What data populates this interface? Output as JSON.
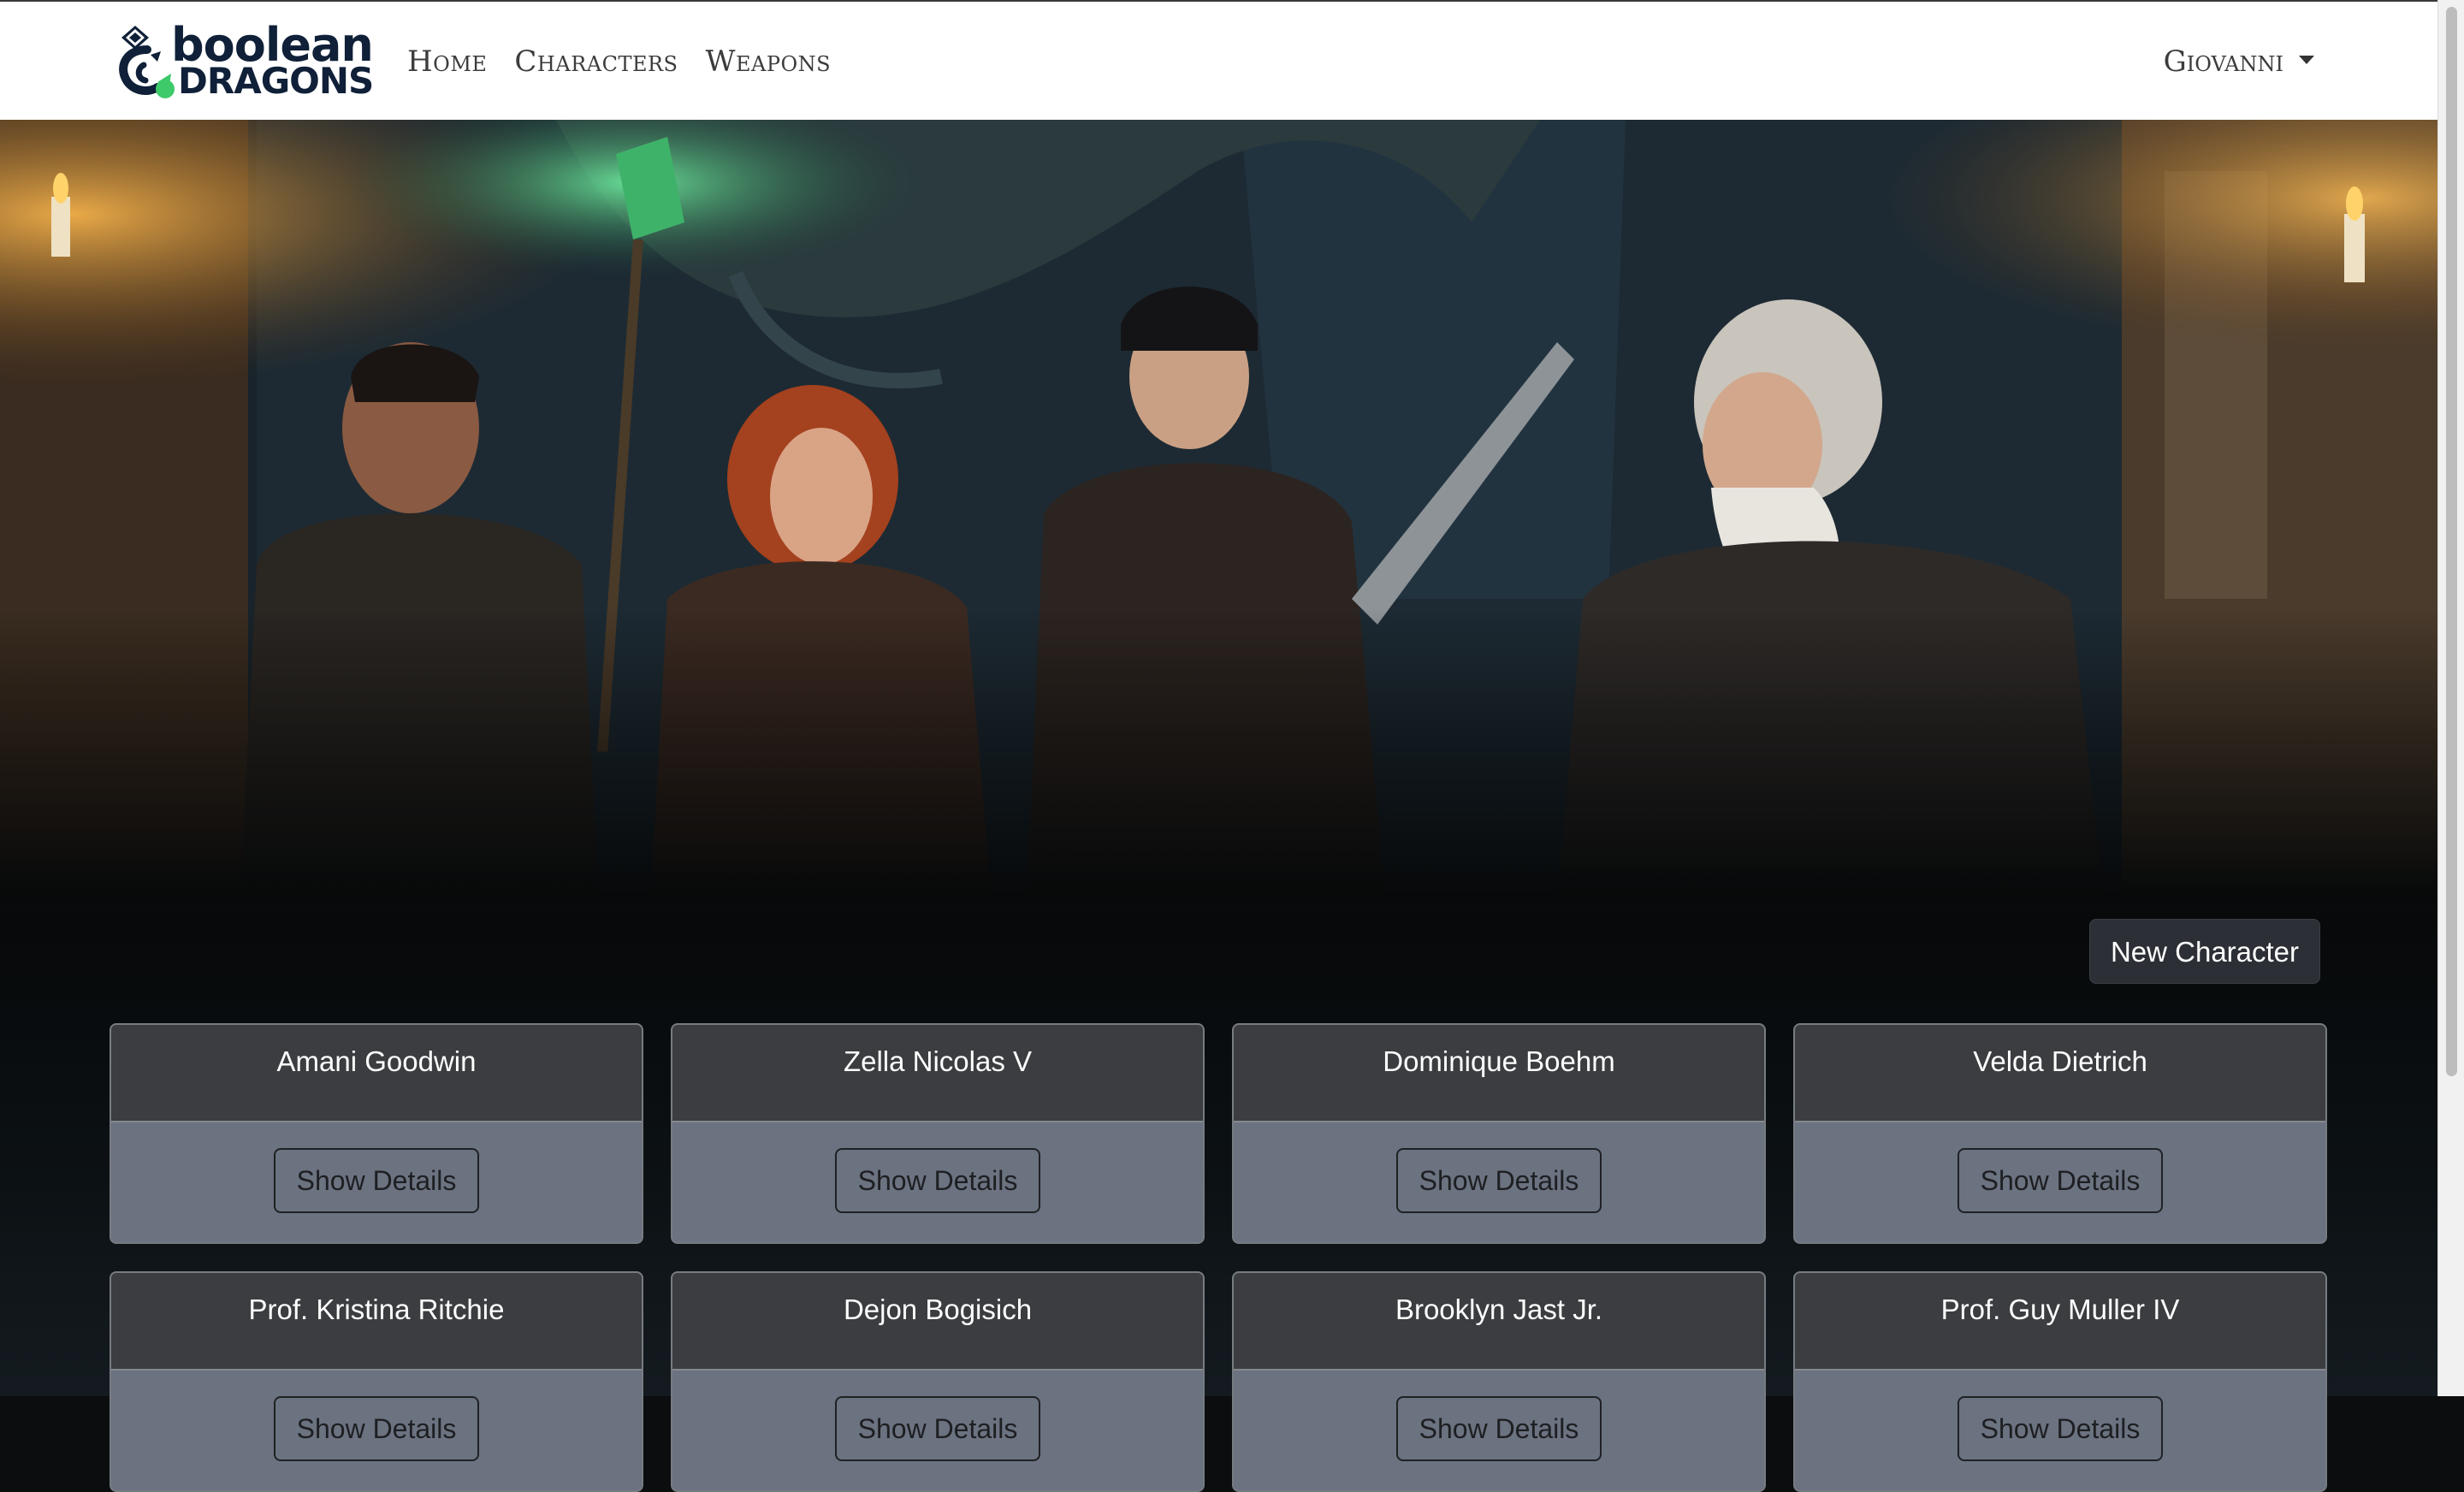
{
  "brand": {
    "logo_line1": "boolean",
    "logo_line2": "DRAGONS",
    "logo_colors": {
      "navy": "#0f2038",
      "green": "#3ec96a"
    }
  },
  "nav": {
    "items": [
      {
        "label": "Home"
      },
      {
        "label": "Characters"
      },
      {
        "label": "Weapons"
      }
    ]
  },
  "user": {
    "name": "Giovanni"
  },
  "actions": {
    "new_character_label": "New Character"
  },
  "characters": [
    {
      "name": "Amani Goodwin",
      "button": "Show Details"
    },
    {
      "name": "Zella Nicolas V",
      "button": "Show Details"
    },
    {
      "name": "Dominique Boehm",
      "button": "Show Details"
    },
    {
      "name": "Velda Dietrich",
      "button": "Show Details"
    },
    {
      "name": "Prof. Kristina Ritchie",
      "button": "Show Details"
    },
    {
      "name": "Dejon Bogisich",
      "button": "Show Details"
    },
    {
      "name": "Brooklyn Jast Jr.",
      "button": "Show Details"
    },
    {
      "name": "Prof. Guy Muller IV",
      "button": "Show Details"
    }
  ],
  "theme": {
    "card_header_bg": "#3b3d40",
    "card_body_bg": "#6b7280",
    "button_dark_bg": "#2c3036"
  }
}
